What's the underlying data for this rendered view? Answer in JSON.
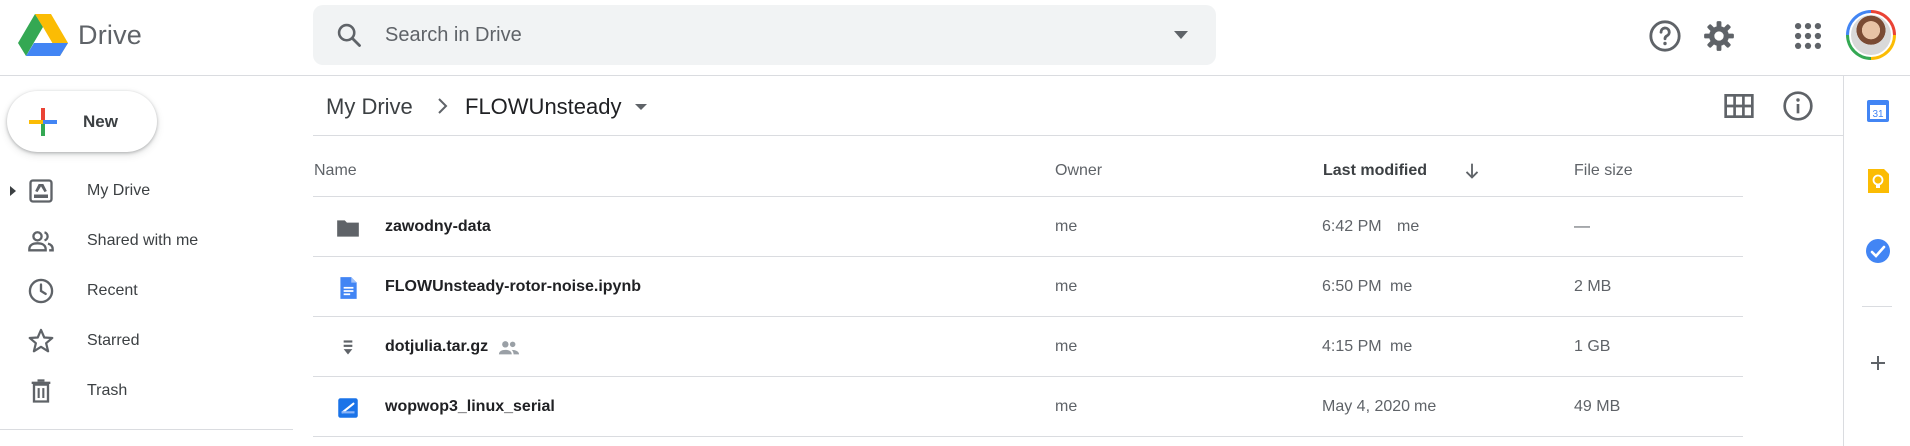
{
  "header": {
    "app_name": "Drive",
    "search_placeholder": "Search in Drive",
    "icons": [
      "drive-logo",
      "search-icon",
      "search-options-caret",
      "help-icon",
      "settings-icon",
      "apps-grid-icon",
      "account-avatar"
    ]
  },
  "sidebar": {
    "new_label": "New",
    "items": [
      {
        "label": "My Drive",
        "icon": "my-drive-icon"
      },
      {
        "label": "Shared with me",
        "icon": "people-icon"
      },
      {
        "label": "Recent",
        "icon": "clock-icon"
      },
      {
        "label": "Starred",
        "icon": "star-icon"
      },
      {
        "label": "Trash",
        "icon": "trash-icon"
      }
    ]
  },
  "breadcrumb": {
    "root": "My Drive",
    "current": "FLOWUnsteady"
  },
  "table": {
    "columns": {
      "name": "Name",
      "owner": "Owner",
      "modified": "Last modified",
      "size": "File size"
    },
    "rows": [
      {
        "name": "zawodny-data",
        "type": "folder",
        "owner": "me",
        "modified": "6:42 PM",
        "modified_by": "me",
        "size": "—",
        "shared": false
      },
      {
        "name": "FLOWUnsteady-rotor-noise.ipynb",
        "type": "doc",
        "owner": "me",
        "modified": "6:50 PM",
        "modified_by": "me",
        "size": "2 MB",
        "shared": false
      },
      {
        "name": "dotjulia.tar.gz",
        "type": "archive",
        "owner": "me",
        "modified": "4:15 PM",
        "modified_by": "me",
        "size": "1 GB",
        "shared": true
      },
      {
        "name": "wopwop3_linux_serial",
        "type": "binary",
        "owner": "me",
        "modified": "May 4, 2020",
        "modified_by": "me",
        "size": "49 MB",
        "shared": false
      }
    ]
  },
  "rail": {
    "icons": [
      "calendar-icon",
      "keep-icon",
      "tasks-icon",
      "add-addon-icon"
    ],
    "calendar_day": "31"
  },
  "colors": {
    "accent_blue": "#4285f4",
    "yellow": "#fbbc04",
    "green": "#34a853",
    "red": "#ea4335",
    "text": "#3c4043",
    "muted": "#5f6368",
    "divider": "#dadce0"
  }
}
